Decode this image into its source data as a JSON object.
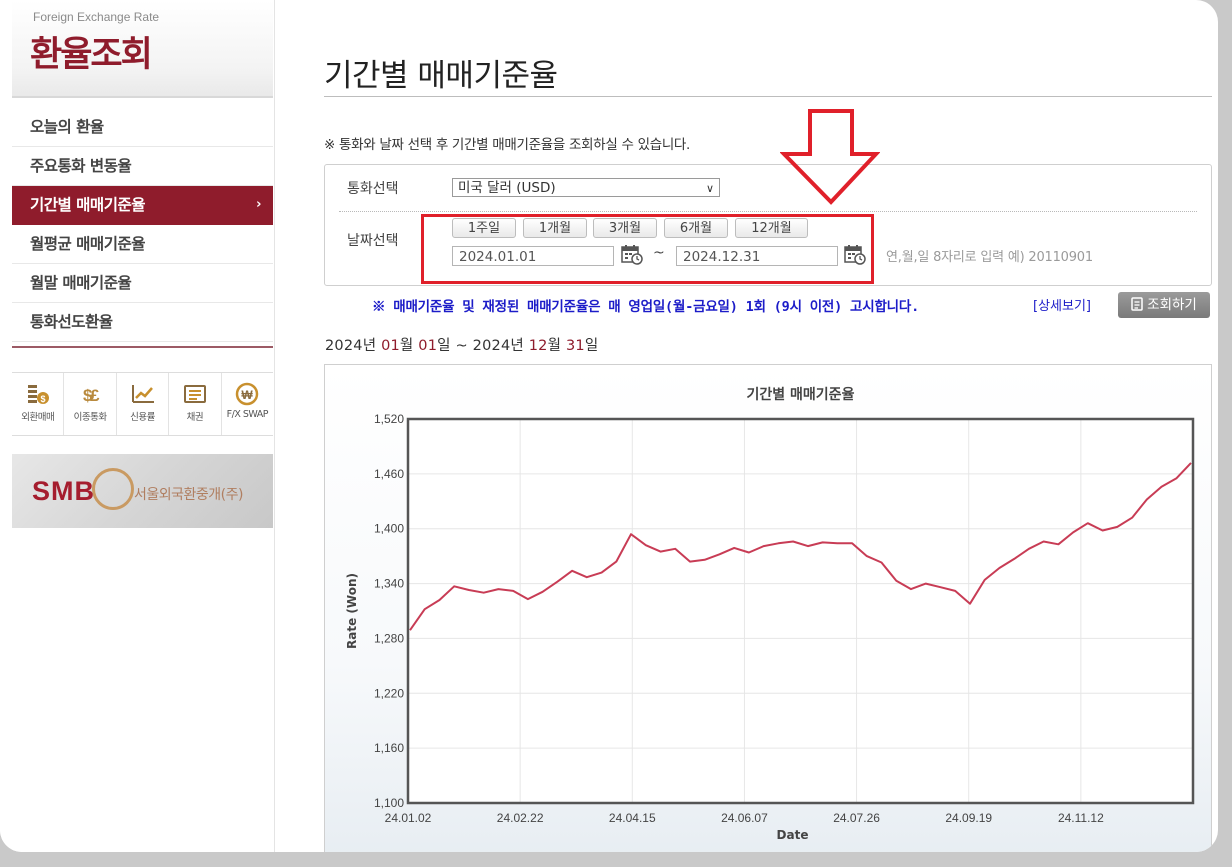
{
  "sidebar": {
    "brand_en": "Foreign Exchange Rate",
    "brand_ko": "환율조회",
    "menu": [
      {
        "label": "오늘의 환율",
        "active": false
      },
      {
        "label": "주요통화 변동율",
        "active": false
      },
      {
        "label": "기간별 매매기준율",
        "active": true
      },
      {
        "label": "월평균 매매기준율",
        "active": false
      },
      {
        "label": "월말 매매기준율",
        "active": false
      },
      {
        "label": "통화선도환율",
        "active": false
      }
    ],
    "quick_links": [
      {
        "label": "외환매매",
        "icon": "fx-trading-icon"
      },
      {
        "label": "이종통화",
        "icon": "cross-currency-icon"
      },
      {
        "label": "신용률",
        "icon": "credit-rate-icon"
      },
      {
        "label": "채권",
        "icon": "bond-icon"
      },
      {
        "label": "F/X SWAP",
        "icon": "fx-swap-icon"
      }
    ],
    "banner": {
      "logo": "SMB",
      "text": "서울외국환중개(주)"
    }
  },
  "main": {
    "title": "기간별 매매기준율",
    "guide": "※ 통화와 날짜 선택 후 기간별 매매기준율을 조회하실 수 있습니다.",
    "currency_label": "통화선택",
    "currency_value": "미국 달러 (USD)",
    "date_label": "날짜선택",
    "period_buttons": [
      "1주일",
      "1개월",
      "3개월",
      "6개월",
      "12개월"
    ],
    "start_date": "2024.01.01",
    "end_date": "2024.12.31",
    "tilde": "~",
    "date_hint": "연,월,일 8자리로 입력 예) 20110901",
    "notice": "※ 매매기준율 및 재정된 매매기준율은 매 영업일(월-금요일) 1회 (9시 이전) 고시합니다.",
    "detail_link": "[상세보기]",
    "search_button": "조회하기",
    "range": {
      "y1": "2024",
      "m1": "01",
      "d1": "01",
      "y2": "2024",
      "m2": "12",
      "d2": "31",
      "year_unit": "년",
      "month_unit": "월",
      "day_unit": "일",
      "sep": "~"
    }
  },
  "colors": {
    "brand": "#8f1c2c",
    "notice": "#1c1cc8",
    "highlight_box": "#e0202a",
    "series_line": "#c83c55"
  },
  "chart_data": {
    "type": "line",
    "title": "기간별 매매기준율",
    "xlabel": "Date",
    "ylabel": "Rate (Won)",
    "ylim": [
      1100,
      1520
    ],
    "yticks": [
      "1,100",
      "1,160",
      "1,220",
      "1,280",
      "1,340",
      "1,400",
      "1,460",
      "1,520"
    ],
    "xticks": [
      "24.01.02",
      "24.02.22",
      "24.04.15",
      "24.06.07",
      "24.07.26",
      "24.09.19",
      "24.11.12"
    ],
    "grid": true,
    "series": [
      {
        "x": [
          "24.01.02",
          "24.01.09",
          "24.01.16",
          "24.01.23",
          "24.01.30",
          "24.02.06",
          "24.02.13",
          "24.02.22",
          "24.02.29",
          "24.03.07",
          "24.03.14",
          "24.03.21",
          "24.03.28",
          "24.04.04",
          "24.04.11",
          "24.04.15",
          "24.04.18",
          "24.04.25",
          "24.05.02",
          "24.05.09",
          "24.05.16",
          "24.05.23",
          "24.05.30",
          "24.06.07",
          "24.06.14",
          "24.06.21",
          "24.06.28",
          "24.07.05",
          "24.07.12",
          "24.07.19",
          "24.07.26",
          "24.08.02",
          "24.08.09",
          "24.08.16",
          "24.08.23",
          "24.08.30",
          "24.09.06",
          "24.09.13",
          "24.09.19",
          "24.09.26",
          "24.10.04",
          "24.10.11",
          "24.10.18",
          "24.10.25",
          "24.11.01",
          "24.11.08",
          "24.11.12",
          "24.11.19",
          "24.11.26",
          "24.12.03",
          "24.12.10",
          "24.12.17",
          "24.12.24",
          "24.12.31"
        ],
        "values": [
          1289,
          1312,
          1322,
          1337,
          1333,
          1330,
          1334,
          1332,
          1323,
          1331,
          1342,
          1354,
          1347,
          1352,
          1364,
          1394,
          1382,
          1375,
          1378,
          1364,
          1366,
          1372,
          1379,
          1374,
          1381,
          1384,
          1386,
          1381,
          1385,
          1384,
          1384,
          1370,
          1363,
          1343,
          1334,
          1340,
          1336,
          1332,
          1318,
          1344,
          1357,
          1367,
          1378,
          1386,
          1383,
          1396,
          1406,
          1398,
          1402,
          1412,
          1432,
          1446,
          1455,
          1472
        ]
      }
    ]
  }
}
